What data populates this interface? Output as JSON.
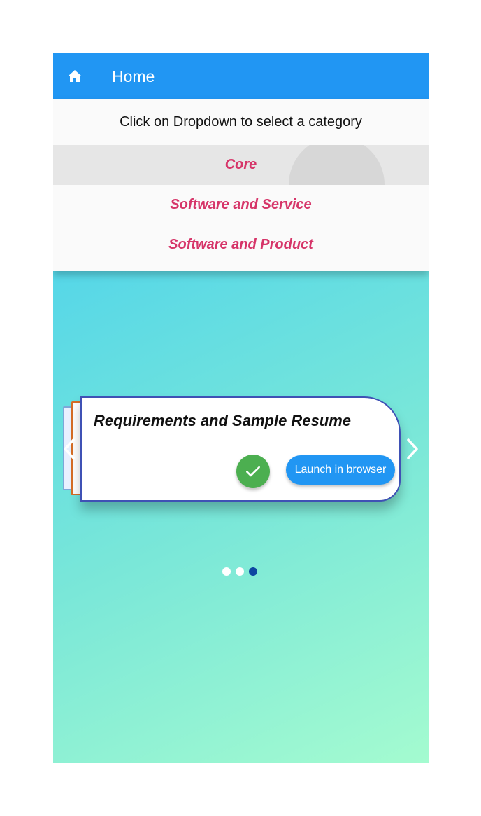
{
  "appbar": {
    "title": "Home",
    "icon": "home-icon"
  },
  "dropdown": {
    "hint": "Click on Dropdown to select a category",
    "items": [
      {
        "label": "Core",
        "selected": true
      },
      {
        "label": "Software and Service",
        "selected": false
      },
      {
        "label": "Software and Product",
        "selected": false
      }
    ],
    "item_color": "#d63569"
  },
  "carousel": {
    "card_title": "Requirements and Sample Resume",
    "launch_label": "Launch in browser",
    "check_icon": "check-icon",
    "prev_icon": "chevron-left-icon",
    "next_icon": "chevron-right-icon",
    "page_count": 3,
    "active_page": 3
  },
  "colors": {
    "appbar": "#2196f3",
    "check_button": "#4caf50",
    "launch_button": "#2196f3",
    "active_dot": "#0d47a1"
  }
}
